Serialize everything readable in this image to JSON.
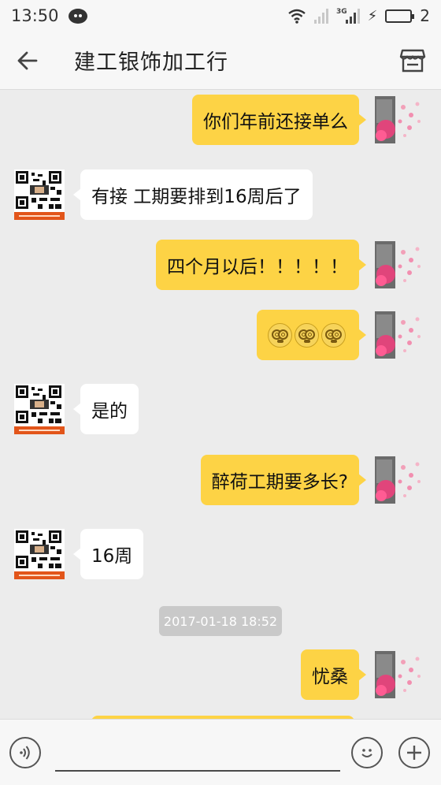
{
  "status_bar": {
    "time": "13:50",
    "network_label": "3G",
    "battery_level": "2",
    "icons": [
      "wechat-icon",
      "wifi-icon",
      "signal-icon",
      "signal-3g-icon",
      "charging-icon",
      "battery-icon"
    ]
  },
  "header": {
    "title": "建工银饰加工行",
    "icons": [
      "back-arrow-icon",
      "shop-icon"
    ]
  },
  "messages": [
    {
      "from": "me",
      "text": "你们年前还接单么"
    },
    {
      "from": "other",
      "text": "有接 工期要排到16周后了"
    },
    {
      "from": "me",
      "text": "四个月以后！！！！！"
    },
    {
      "from": "me",
      "type": "emoji",
      "emoji": [
        "dizzy-face-emoji",
        "dizzy-face-emoji",
        "dizzy-face-emoji"
      ]
    },
    {
      "from": "other",
      "text": "是的"
    },
    {
      "from": "me",
      "text": "醉荷工期要多长?"
    },
    {
      "from": "other",
      "text": "16周"
    },
    {
      "type": "timestamp",
      "text": "2017-01-18 18:52"
    },
    {
      "from": "me",
      "text": "忧桑"
    }
  ],
  "input_bar": {
    "text_value": "",
    "icons": [
      "voice-icon",
      "emoji-face-icon",
      "plus-icon"
    ]
  },
  "colors": {
    "my_bubble": "#fdd345",
    "other_bubble": "#ffffff",
    "chat_background": "#ececec",
    "bar_background": "#f7f7f7"
  }
}
